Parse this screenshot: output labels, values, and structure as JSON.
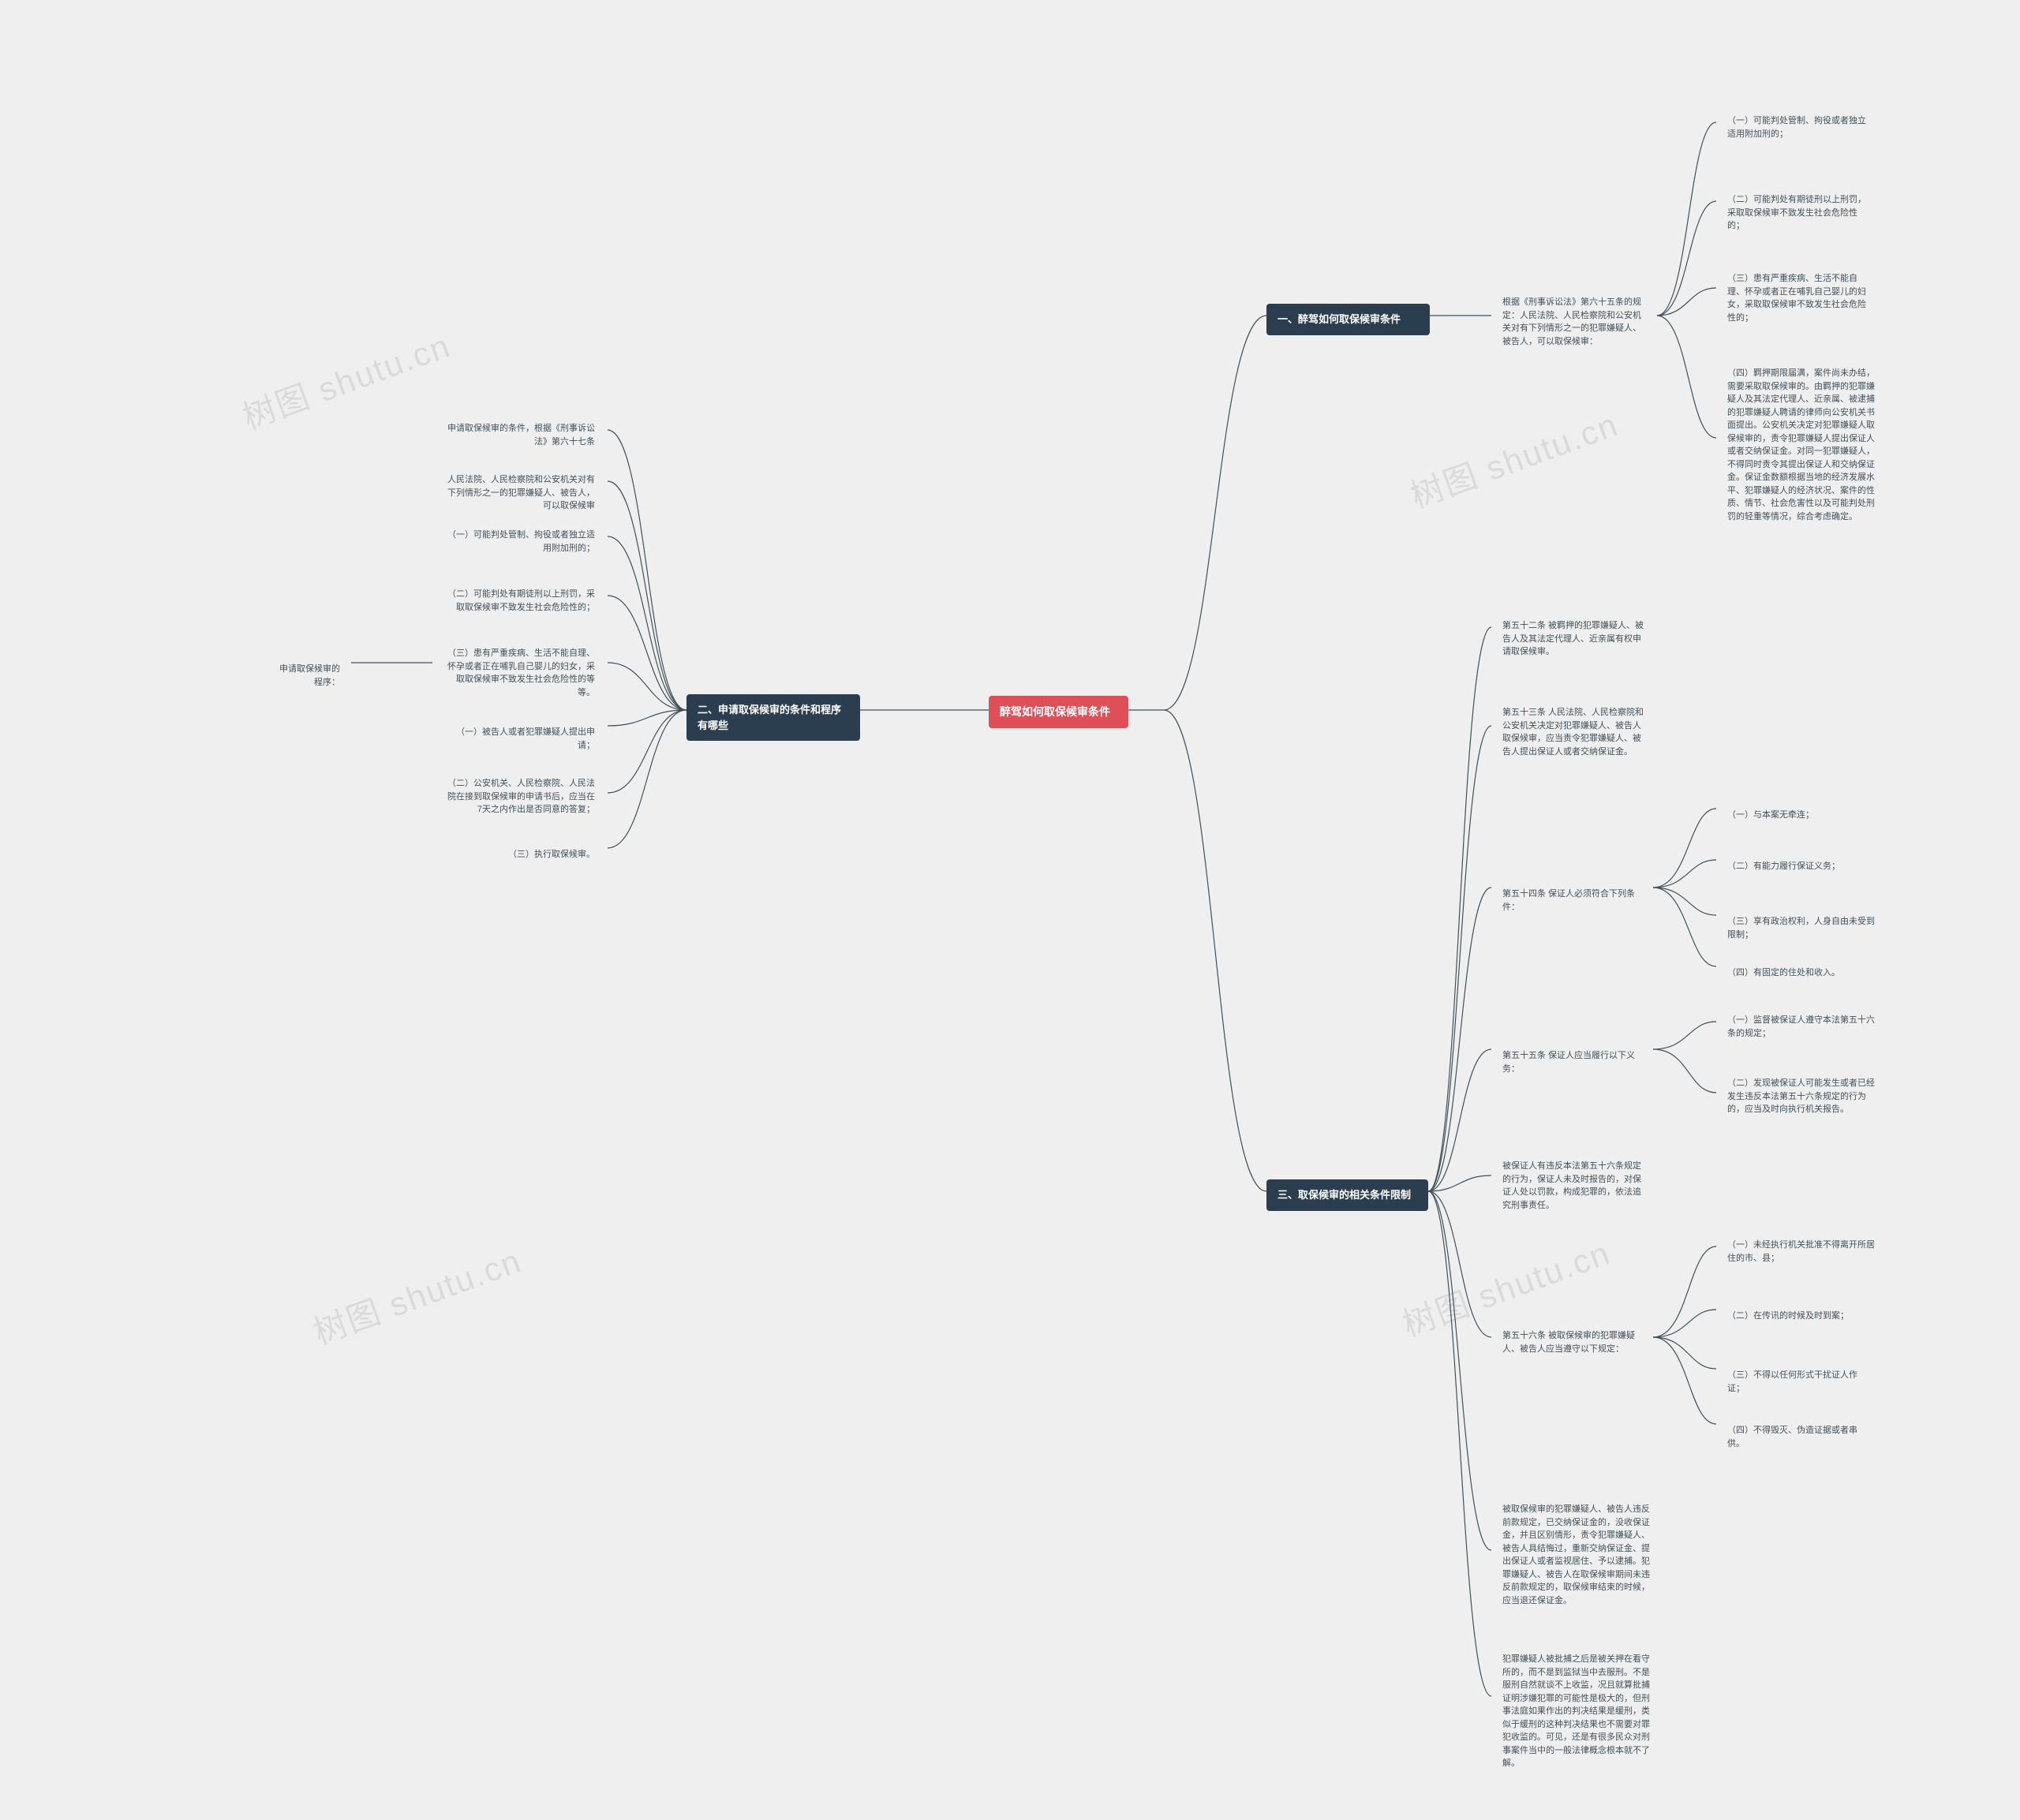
{
  "watermark": "树图 shutu.cn",
  "root": {
    "title": "醉驾如何取保候审条件"
  },
  "branch1": {
    "title": "一、醉驾如何取保候审条件",
    "intro": "根据《刑事诉讼法》第六十五条的规定：人民法院、人民检察院和公安机关对有下列情形之一的犯罪嫌疑人、被告人，可以取保候审：",
    "items": [
      "（一）可能判处管制、拘役或者独立适用附加刑的；",
      "（二）可能判处有期徒刑以上刑罚，采取取保候审不致发生社会危险性的；",
      "（三）患有严重疾病、生活不能自理、怀孕或者正在哺乳自己婴儿的妇女，采取取保候审不致发生社会危险性的；",
      "（四）羁押期限届满，案件尚未办结，需要采取取保候审的。由羁押的犯罪嫌疑人及其法定代理人、近亲属、被逮捕的犯罪嫌疑人聘请的律师向公安机关书面提出。公安机关决定对犯罪嫌疑人取保候审的，责令犯罪嫌疑人提出保证人或者交纳保证金。对同一犯罪嫌疑人，不得同时责令其提出保证人和交纳保证金。保证金数额根据当地的经济发展水平、犯罪嫌疑人的经济状况、案件的性质、情节、社会危害性以及可能判处刑罚的轻重等情况，综合考虑确定。"
    ]
  },
  "branch2": {
    "title": "二、申请取保候审的条件和程序有哪些",
    "items": [
      "申请取保候审的条件，根据《刑事诉讼法》第六十七条",
      "人民法院、人民检察院和公安机关对有下列情形之一的犯罪嫌疑人、被告人，可以取保候审",
      "（一）可能判处管制、拘役或者独立适用附加刑的；",
      "（二）可能判处有期徒刑以上刑罚，采取取保候审不致发生社会危险性的；",
      "（三）患有严重疾病、生活不能自理、怀孕或者正在哺乳自己婴儿的妇女，采取取保候审不致发生社会危险性的等等。",
      "（一）被告人或者犯罪嫌疑人提出申请；",
      "（二）公安机关、人民检察院、人民法院在接到取保候审的申请书后，应当在7天之内作出是否同意的答复；",
      "（三）执行取保候审。"
    ],
    "sublabel": "申请取保候审的程序："
  },
  "branch3": {
    "title": "三、取保候审的相关条件限制",
    "a52": "第五十二条 被羁押的犯罪嫌疑人、被告人及其法定代理人、近亲属有权申请取保候审。",
    "a53": "第五十三条 人民法院、人民检察院和公安机关决定对犯罪嫌疑人、被告人取保候审，应当责令犯罪嫌疑人、被告人提出保证人或者交纳保证金。",
    "a54": {
      "head": "第五十四条 保证人必须符合下列条件：",
      "items": [
        "（一）与本案无牵连；",
        "（二）有能力履行保证义务；",
        "（三）享有政治权利，人身自由未受到限制；",
        "（四）有固定的住处和收入。"
      ]
    },
    "a55": {
      "head": "第五十五条 保证人应当履行以下义务：",
      "items": [
        "（一）监督被保证人遵守本法第五十六条的规定；",
        "（二）发现被保证人可能发生或者已经发生违反本法第五十六条规定的行为的，应当及时向执行机关报告。"
      ],
      "tail": "被保证人有违反本法第五十六条规定的行为，保证人未及时报告的，对保证人处以罚款，构成犯罪的，依法追究刑事责任。"
    },
    "a56": {
      "head": "第五十六条 被取保候审的犯罪嫌疑人、被告人应当遵守以下规定：",
      "items": [
        "（一）未经执行机关批准不得离开所居住的市、县；",
        "（二）在传讯的时候及时到案；",
        "（三）不得以任何形式干扰证人作证；",
        "（四）不得毁灭、伪造证据或者串供。"
      ],
      "tail": "被取保候审的犯罪嫌疑人、被告人违反前款规定，已交纳保证金的，没收保证金，并且区别情形，责令犯罪嫌疑人、被告人具结悔过，重新交纳保证金、提出保证人或者监视居住、予以逮捕。犯罪嫌疑人、被告人在取保候审期间未违反前款规定的，取保候审结束的时候，应当退还保证金。"
    },
    "tail": "犯罪嫌疑人被批捕之后是被关押在看守所的，而不是到监狱当中去服刑。不是服刑自然就谈不上收监，况且就算批捕证明涉嫌犯罪的可能性是极大的，但刑事法庭如果作出的判决结果是缓刑，类似于缓刑的这种判决结果也不需要对罪犯收监的。可见，还是有很多民众对刑事案件当中的一般法律概念根本就不了解。"
  }
}
